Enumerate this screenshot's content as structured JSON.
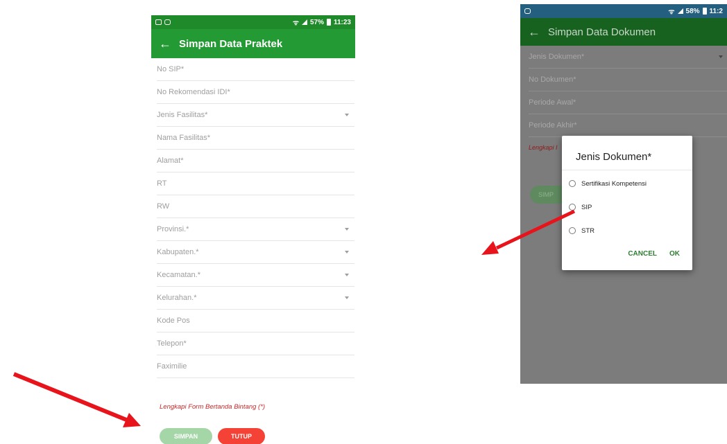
{
  "left_phone": {
    "status": {
      "battery": "57%",
      "time": "11:23"
    },
    "title": "Simpan Data Praktek",
    "fields": [
      {
        "label": "No SIP*",
        "dropdown": false
      },
      {
        "label": "No Rekomendasi IDI*",
        "dropdown": false
      },
      {
        "label": "Jenis Fasilitas*",
        "dropdown": true
      },
      {
        "label": "Nama Fasilitas*",
        "dropdown": false
      },
      {
        "label": "Alamat*",
        "dropdown": false
      },
      {
        "label": "RT",
        "dropdown": false
      },
      {
        "label": "RW",
        "dropdown": false
      },
      {
        "label": "Provinsi.*",
        "dropdown": true
      },
      {
        "label": "Kabupaten.*",
        "dropdown": true
      },
      {
        "label": "Kecamatan.*",
        "dropdown": true
      },
      {
        "label": "Kelurahan.*",
        "dropdown": true
      },
      {
        "label": "Kode Pos",
        "dropdown": false
      },
      {
        "label": "Telepon*",
        "dropdown": false
      },
      {
        "label": "Faximilie",
        "dropdown": false
      }
    ],
    "warning": "Lengkapi Form Bertanda Bintang (*)",
    "buttons": {
      "save": "SIMPAN",
      "close": "TUTUP"
    }
  },
  "right_phone": {
    "status": {
      "battery": "58%",
      "time": "11:2"
    },
    "title": "Simpan Data Dokumen",
    "fields": [
      {
        "label": "Jenis Dokumen*",
        "dropdown": true
      },
      {
        "label": "No Dokumen*",
        "dropdown": false
      },
      {
        "label": "Periode Awal*",
        "dropdown": false
      },
      {
        "label": "Periode Akhir*",
        "dropdown": false
      }
    ],
    "warning": "Lengkapi I",
    "button": "SIMP",
    "dialog": {
      "title": "Jenis Dokumen*",
      "options": [
        "Sertifikasi Kompetensi",
        "SIP",
        "STR"
      ],
      "cancel": "CANCEL",
      "ok": "OK"
    }
  },
  "colors": {
    "accent_green": "#249a34",
    "arrow_red": "#e8141b",
    "tutup_red": "#f44336"
  }
}
